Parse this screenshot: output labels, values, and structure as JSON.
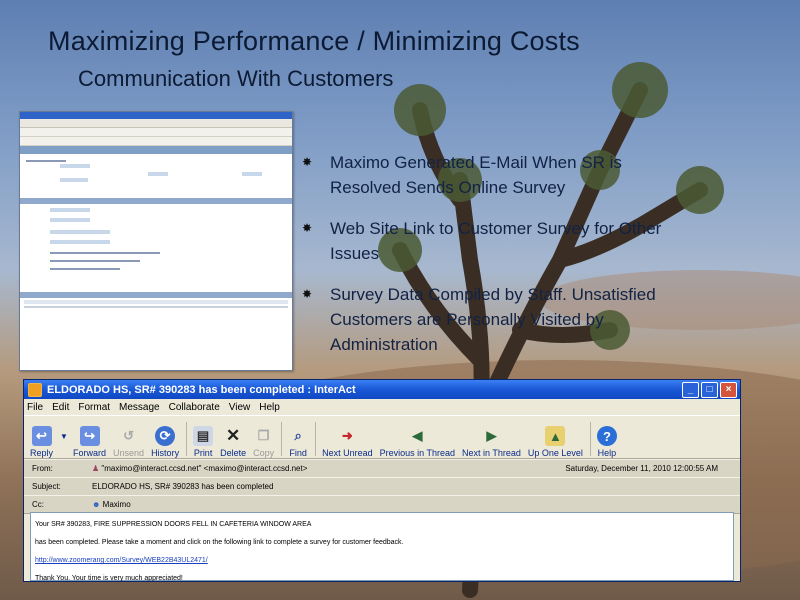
{
  "slide": {
    "title": "Maximizing Performance / Minimizing Costs",
    "subtitle": "Communication With Customers",
    "bullets": [
      "Maximo Generated E-Mail When SR is Resolved Sends Online Survey",
      "Web Site Link to Customer Survey for Other Issues",
      "Survey Data Compiled by Staff. Unsatisfied Customers are Personally Visited by Administration"
    ]
  },
  "email": {
    "window_title": "ELDORADO HS, SR# 390283 has been completed : InterAct",
    "menu": [
      "File",
      "Edit",
      "Format",
      "Message",
      "Collaborate",
      "View",
      "Help"
    ],
    "toolbar": [
      {
        "label": "Reply",
        "icon": "reply-icon"
      },
      {
        "label": "Forward",
        "icon": "forward-icon"
      },
      {
        "label": "Unsend",
        "icon": "unsend-icon"
      },
      {
        "label": "History",
        "icon": "history-icon"
      },
      {
        "label": "Print",
        "icon": "print-icon"
      },
      {
        "label": "Delete",
        "icon": "delete-icon"
      },
      {
        "label": "Copy",
        "icon": "copy-icon"
      },
      {
        "label": "Find",
        "icon": "find-icon"
      },
      {
        "label": "Next Unread",
        "icon": "next-unread-icon"
      },
      {
        "label": "Previous in Thread",
        "icon": "previous-thread-icon"
      },
      {
        "label": "Next in Thread",
        "icon": "next-thread-icon"
      },
      {
        "label": "Up One Level",
        "icon": "up-level-icon"
      },
      {
        "label": "Help",
        "icon": "help-icon"
      }
    ],
    "from_label": "From:",
    "from": "\"maximo@interact.ccsd.net\" <maximo@interact.ccsd.net>",
    "date": "Saturday, December 11, 2010 12:00:55 AM",
    "subject_label": "Subject:",
    "subject": "ELDORADO HS, SR# 390283 has been completed",
    "cc_label": "Cc:",
    "cc": "Maximo",
    "body_lines": [
      "Your SR# 390283, FIRE SUPPRESSION DOORS FELL IN CAFETERIA WINDOW AREA",
      "has been completed. Please take a moment and click on the following link to complete a survey for customer feedback.",
      "http://www.zoomerang.com/Survey/WEB22B43UL2471/",
      "Thank You.  Your time is very much appreciated!"
    ]
  },
  "colors": {
    "titlebar": "#1a58d6",
    "window_bg": "#ece9d8",
    "slide_text": "#0c1a33"
  }
}
